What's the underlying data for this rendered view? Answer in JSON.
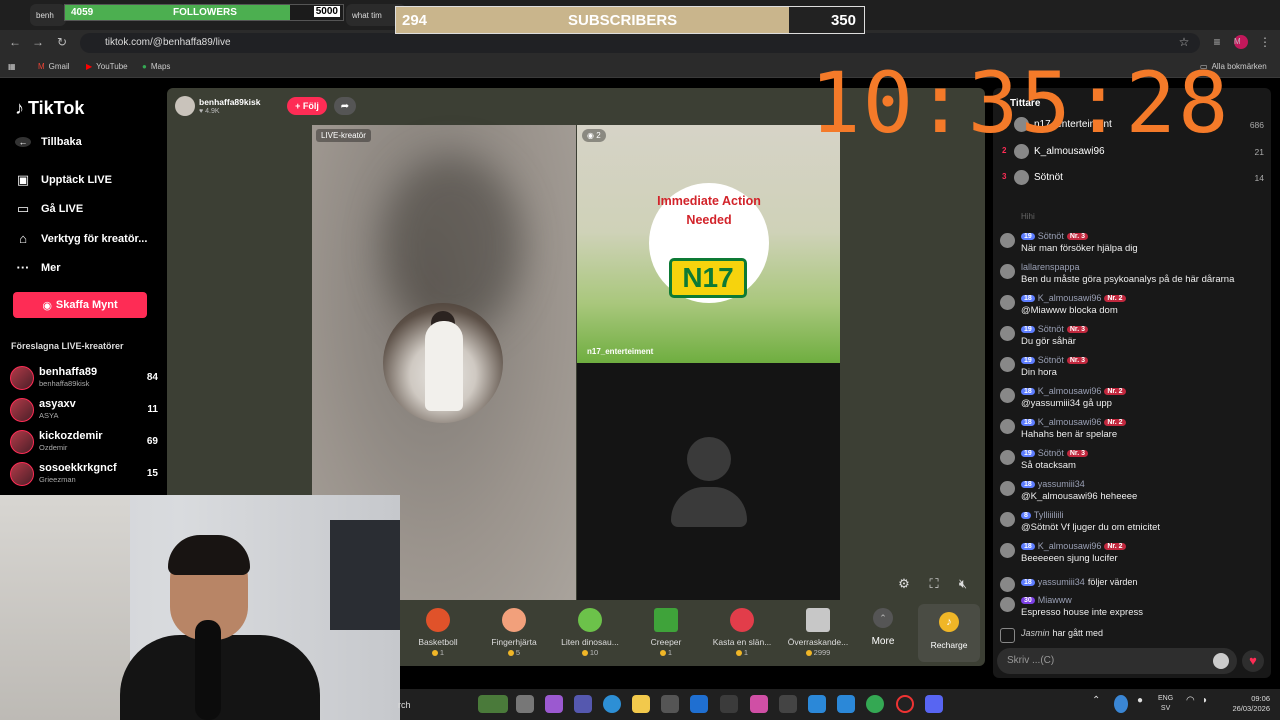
{
  "browser": {
    "tabs": [
      "benh",
      "what tim"
    ],
    "url": "tiktok.com/@benhaffa89/live",
    "bookmarks": [
      "Gmail",
      "YouTube",
      "Maps"
    ],
    "all_bookmarks": "Alla bokmärken"
  },
  "overlay": {
    "followers": {
      "current": "4059",
      "label": "FOLLOWERS",
      "goal": "5000",
      "progress": 0.81
    },
    "subscribers": {
      "current": "294",
      "label": "SUBSCRIBERS",
      "goal": "350",
      "progress": 0.84
    },
    "clock": "10:35:28"
  },
  "sidebar": {
    "logo": "TikTok",
    "back": "Tillbaka",
    "nav": [
      "Upptäck LIVE",
      "Gå LIVE",
      "Verktyg för kreatör...",
      "Mer"
    ],
    "coin_button": "Skaffa Mynt",
    "suggested_title": "Föreslagna LIVE-kreatörer",
    "creators": [
      {
        "name": "benhaffa89",
        "sub": "benhaffa89kisk",
        "count": "84"
      },
      {
        "name": "asyaxv",
        "sub": "ASYA",
        "count": "11"
      },
      {
        "name": "kickozdemir",
        "sub": "Ozdemir",
        "count": "69"
      },
      {
        "name": "sosoekkrkgncf",
        "sub": "Grieezman",
        "count": "15"
      }
    ]
  },
  "stage": {
    "host_name": "benhaffa89kisk",
    "host_likes": "4.9K",
    "follow": "+ Följ",
    "label_left": "LIVE-kreatör",
    "label_right_badge": "2",
    "right_name": "n17_enterteiment",
    "brand_text": "Immediate Action Needed",
    "brand_badge": "N17"
  },
  "gifts": [
    {
      "name": "Basketboll",
      "price": "1",
      "color": "#e0522a"
    },
    {
      "name": "Fingerhjärta",
      "price": "5",
      "color": "#f2a07b"
    },
    {
      "name": "Liten dinosau...",
      "price": "10",
      "color": "#6cc24a"
    },
    {
      "name": "Creeper",
      "price": "1",
      "color": "#3fa33a"
    },
    {
      "name": "Kasta en slän...",
      "price": "1",
      "color": "#e23d4a"
    },
    {
      "name": "Överraskande...",
      "price": "2999",
      "color": "#c7c7c7"
    }
  ],
  "gift_more": "More",
  "recharge": "Recharge",
  "chat": {
    "title": "Tittare",
    "ranking": [
      {
        "num": "1",
        "name": "n17_enterteiment",
        "score": "686"
      },
      {
        "num": "2",
        "name": "K_almousawi96",
        "score": "21"
      },
      {
        "num": "3",
        "name": "Sötnöt",
        "score": "14"
      }
    ],
    "faded": "Hihi",
    "messages": [
      {
        "lvl": "19",
        "name": "Sötnöt",
        "rank": "Nr. 3",
        "text": "När man försöker hjälpa dig"
      },
      {
        "lvl": "",
        "name": "lallarenspappa",
        "rank": "",
        "text": "Ben du måste göra psykoanalys på de här dårarna"
      },
      {
        "lvl": "18",
        "name": "K_almousawi96",
        "rank": "Nr. 2",
        "text": "@Miawww blocka dom"
      },
      {
        "lvl": "19",
        "name": "Sötnöt",
        "rank": "Nr. 3",
        "text": "Du gör såhär"
      },
      {
        "lvl": "19",
        "name": "Sötnöt",
        "rank": "Nr. 3",
        "text": "Din hora"
      },
      {
        "lvl": "18",
        "name": "K_almousawi96",
        "rank": "Nr. 2",
        "text": "@yassumiii34 gå upp"
      },
      {
        "lvl": "18",
        "name": "K_almousawi96",
        "rank": "Nr. 2",
        "text": "Hahahs ben är spelare"
      },
      {
        "lvl": "19",
        "name": "Sötnöt",
        "rank": "Nr. 3",
        "text": "Så otacksam"
      },
      {
        "lvl": "18",
        "name": "yassumiii34",
        "rank": "",
        "text": "@K_almousawi96 heheeee"
      },
      {
        "lvl": "8",
        "name": "Tylliiiliili",
        "rank": "",
        "text": "@Sötnöt Vf ljuger du om etnicitet"
      },
      {
        "lvl": "18",
        "name": "K_almousawi96",
        "rank": "Nr. 2",
        "text": "Beeeeeen sjung lucifer"
      }
    ],
    "follow_msg": {
      "lvl": "18",
      "name": "yassumiii34",
      "text": "följer värden"
    },
    "last_msg": {
      "lvl": "30",
      "name": "Miawww",
      "text": "Espresso house inte express"
    },
    "join_msg": {
      "name": "Jasmin",
      "text": "har gått med"
    },
    "input_placeholder": "Skriv ...(C)"
  },
  "taskbar": {
    "search": "rch",
    "lang": [
      "ENG",
      "SV"
    ],
    "time": "09:06",
    "date": "26/03/2026"
  }
}
